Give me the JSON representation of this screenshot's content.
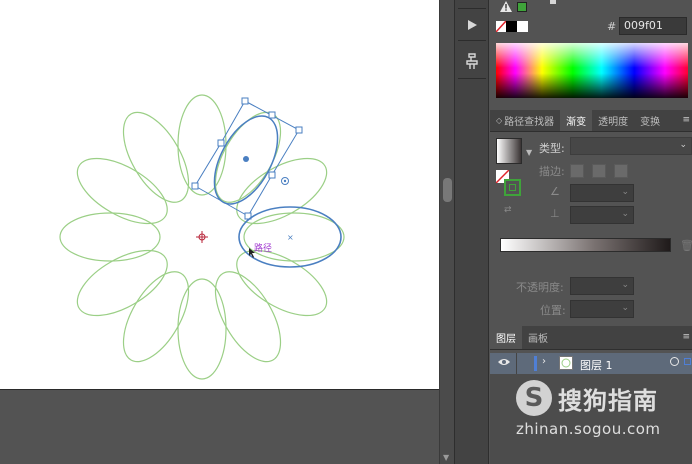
{
  "color": {
    "hex_sign": "#",
    "hex_value": "009f01",
    "fill_color": "#3fa33a"
  },
  "tabs_top": [
    {
      "label": "路径查找器",
      "active": false,
      "has_updown": true
    },
    {
      "label": "渐变",
      "active": true,
      "has_updown": false
    },
    {
      "label": "透明度",
      "active": false,
      "has_updown": false
    },
    {
      "label": "变换",
      "active": false,
      "has_updown": false
    }
  ],
  "gradient": {
    "type_label": "类型:",
    "stroke_label": "描边:",
    "opacity_label": "不透明度:",
    "position_label": "位置:"
  },
  "tabs_layers": [
    {
      "label": "图层",
      "active": true
    },
    {
      "label": "画板",
      "active": false
    }
  ],
  "layers": [
    {
      "name": "图层 1",
      "color": "#4f7fd6"
    }
  ],
  "canvas": {
    "path_label": "路径",
    "path_color": "#a23bd0",
    "ellipse_color": "#9bcf86",
    "selection_color": "#4a7fc1"
  },
  "watermark": {
    "brand_cn": "搜狗指南",
    "url": "zhinan.sogou.com"
  },
  "icons": {
    "warning": "warning-icon",
    "play": "play-icon",
    "puppet": "puppet-warp-icon",
    "eye": "eye-icon",
    "chevron": "chevron-right-icon"
  }
}
